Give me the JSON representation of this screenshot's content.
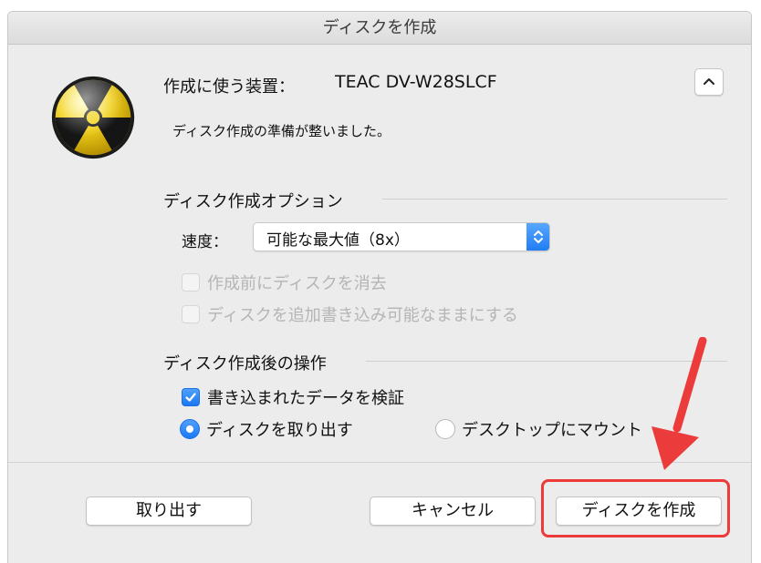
{
  "window": {
    "title": "ディスクを作成"
  },
  "device": {
    "label": "作成に使う装置：",
    "name": "TEAC DV-W28SLCF"
  },
  "status": {
    "text": "ディスク作成の準備が整いました。"
  },
  "options": {
    "title": "ディスク作成オプション",
    "speed_label": "速度：",
    "speed_value": "可能な最大値（8x）",
    "erase_label": "作成前にディスクを消去",
    "erase_checked": false,
    "erase_enabled": false,
    "appendable_label": "ディスクを追加書き込み可能なままにする",
    "appendable_checked": false,
    "appendable_enabled": false
  },
  "after": {
    "title": "ディスク作成後の操作",
    "verify_label": "書き込まれたデータを検証",
    "verify_checked": true,
    "eject_label": "ディスクを取り出す",
    "eject_selected": true,
    "mount_label": "デスクトップにマウント",
    "mount_selected": false
  },
  "buttons": {
    "eject": "取り出す",
    "cancel": "キャンセル",
    "burn": "ディスクを作成"
  },
  "icons": {
    "burn": "radiation-burn-icon",
    "collapse": "chevron-up-icon",
    "select": "up-down-chevron-icon",
    "check": "checkmark-icon",
    "annotation": "red-arrow-icon"
  },
  "colors": {
    "accent": "#1e7cf3",
    "annotation": "#ec3b3b",
    "window_bg": "#ececec"
  }
}
